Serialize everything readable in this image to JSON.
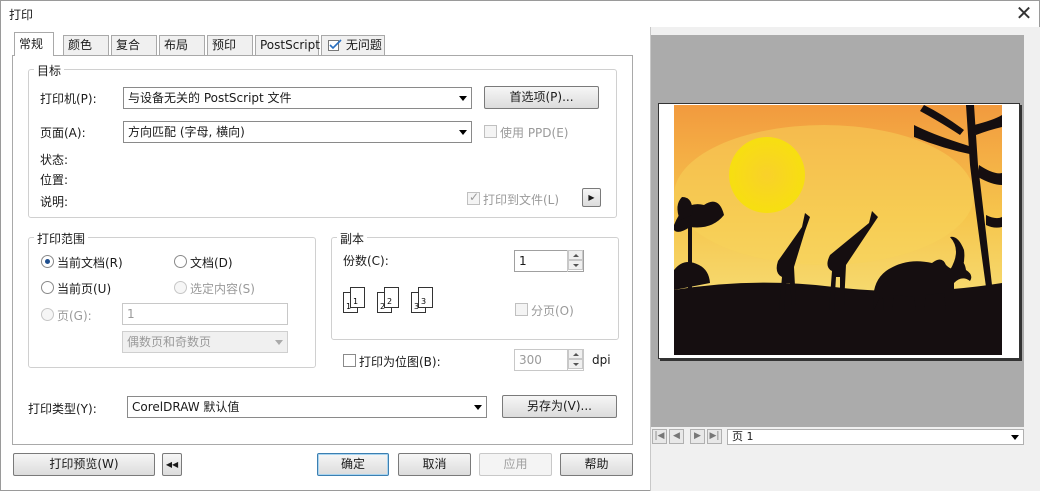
{
  "window": {
    "title": "打印",
    "close_glyph": "✕"
  },
  "tabs": [
    {
      "label": "常规",
      "active": true
    },
    {
      "label": "颜色"
    },
    {
      "label": "复合"
    },
    {
      "label": "布局"
    },
    {
      "label": "预印"
    },
    {
      "label": "PostScript"
    },
    {
      "label": "无问题",
      "icon": "check-icon"
    }
  ],
  "destination": {
    "legend": "目标",
    "printer_label": "打印机(P):",
    "printer_value": "与设备无关的 PostScript 文件",
    "preferences_button": "首选项(P)...",
    "page_label": "页面(A):",
    "page_value": "方向匹配 (字母, 横向)",
    "use_ppd_label": "使用 PPD(E)",
    "use_ppd_checked": false,
    "status_label": "状态:",
    "location_label": "位置:",
    "comment_label": "说明:",
    "print_to_file_label": "打印到文件(L)",
    "print_to_file_checked": true
  },
  "print_range": {
    "legend": "打印范围",
    "current_document": "当前文档(R)",
    "documents": "文档(D)",
    "current_page": "当前页(U)",
    "selection": "选定内容(S)",
    "pages_label": "页(G):",
    "pages_value": "1",
    "page_set": "偶数页和奇数页",
    "selected": "当前文档(R)"
  },
  "copies": {
    "legend": "副本",
    "count_label": "份数(C):",
    "count_value": "1",
    "collate_label": "分页(O)",
    "collate_checked": false,
    "collate_glyphs": [
      "1",
      "1",
      "2",
      "2",
      "3",
      "3"
    ]
  },
  "bitmap": {
    "label": "打印为位图(B):",
    "checked": false,
    "dpi_value": "300",
    "dpi_unit": "dpi"
  },
  "print_style": {
    "label": "打印类型(Y):",
    "value": "CorelDRAW 默认值",
    "save_as_button": "另存为(V)..."
  },
  "footer": {
    "print_preview_button": "打印预览(W)",
    "collapse_glyph": "◀◀",
    "ok_button": "确定",
    "cancel_button": "取消",
    "apply_button": "应用",
    "help_button": "帮助"
  },
  "preview": {
    "page_selector": "页 1",
    "nav_glyphs": [
      "|◀",
      "◀",
      "▶",
      "▶|"
    ],
    "colors": {
      "sky_top": "#f29a3e",
      "sky_bottom": "#f6e98a",
      "sun": "#f7df10",
      "silhouette": "#150e10"
    }
  }
}
